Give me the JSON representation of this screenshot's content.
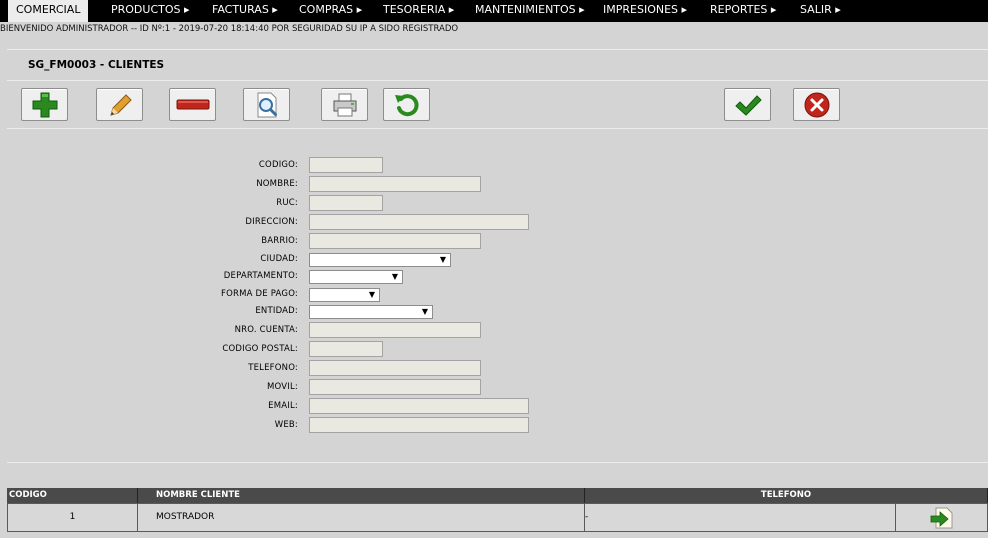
{
  "menu": [
    {
      "label": "COMERCIAL"
    },
    {
      "label": "PRODUCTOS ▸"
    },
    {
      "label": "FACTURAS ▸"
    },
    {
      "label": "COMPRAS ▸"
    },
    {
      "label": "TESORERIA ▸"
    },
    {
      "label": "MANTENIMIENTOS ▸"
    },
    {
      "label": "IMPRESIONES ▸"
    },
    {
      "label": "REPORTES ▸"
    },
    {
      "label": "SALIR ▸"
    }
  ],
  "welcome": "BIENVENIDO ADMINISTRADOR -- ID Nº:1 - 2019-07-20 18:14:40 POR SEGURIDAD SU IP A SIDO REGISTRADO",
  "form_title": "SG_FM0003 - CLIENTES",
  "toolbar": {
    "add_icon": "plus-icon",
    "edit_icon": "pencil-icon",
    "delete_icon": "minus-icon",
    "search_icon": "magnifier-icon",
    "print_icon": "printer-icon",
    "refresh_icon": "refresh-icon",
    "confirm_icon": "checkmark-icon",
    "cancel_icon": "close-icon",
    "colors": {
      "green": "#2a8a1f",
      "red": "#c0261c",
      "orange": "#e0a030"
    }
  },
  "form": {
    "codigo": {
      "label": "CODIGO:",
      "value": ""
    },
    "nombre": {
      "label": "NOMBRE:",
      "value": ""
    },
    "ruc": {
      "label": "RUC:",
      "value": ""
    },
    "direccion": {
      "label": "DIRECCION:",
      "value": ""
    },
    "barrio": {
      "label": "BARRIO:",
      "value": ""
    },
    "ciudad": {
      "label": "CIUDAD:",
      "value": ""
    },
    "departamento": {
      "label": "DEPARTAMENTO:",
      "value": ""
    },
    "forma_pago": {
      "label": "FORMA DE PAGO:",
      "value": ""
    },
    "entidad": {
      "label": "ENTIDAD:",
      "value": ""
    },
    "nro_cuenta": {
      "label": "NRO. CUENTA:",
      "value": ""
    },
    "codigo_postal": {
      "label": "CODIGO POSTAL:",
      "value": ""
    },
    "telefono": {
      "label": "TELEFONO:",
      "value": ""
    },
    "movil": {
      "label": "MOVIL:",
      "value": ""
    },
    "email": {
      "label": "EMAIL:",
      "value": ""
    },
    "web": {
      "label": "WEB:",
      "value": ""
    }
  },
  "table": {
    "headers": {
      "codigo": "CODIGO",
      "nombre": "NOMBRE CLIENTE",
      "telefono": "TELEFONO"
    },
    "rows": [
      {
        "codigo": "1",
        "nombre": "MOSTRADOR",
        "telefono": "-",
        "action_icon": "select-arrow-icon"
      }
    ]
  }
}
